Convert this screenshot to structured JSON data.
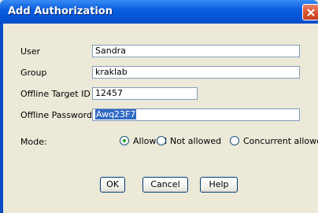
{
  "window": {
    "title": "Add Authorization"
  },
  "form": {
    "user_label": "User",
    "user_value": "Sandra",
    "group_label": "Group",
    "group_value": "kraklab",
    "target_id_label": "Offline Target ID",
    "target_id_value": "12457",
    "password_label": "Offline Password",
    "password_value": "Awq23F7"
  },
  "mode": {
    "label": "Mode:",
    "options": [
      "Allowed",
      "Not allowed",
      "Concurrent allowed"
    ],
    "selected": "Allowed"
  },
  "buttons": {
    "ok": "OK",
    "cancel": "Cancel",
    "help": "Help"
  },
  "colors": {
    "titlebar": "#0a5fe0",
    "selection": "#316ac5",
    "close_button": "#d8512f"
  }
}
